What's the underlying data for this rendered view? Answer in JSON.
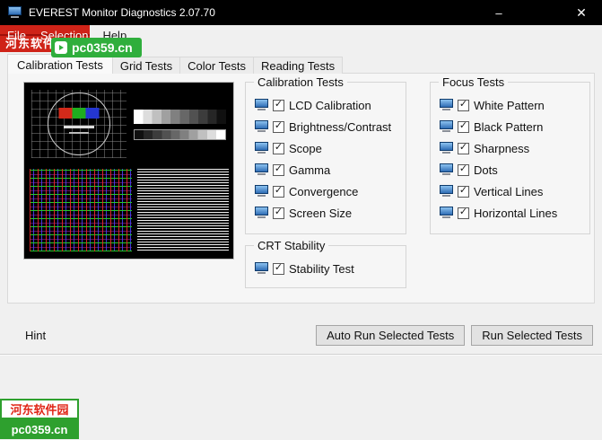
{
  "window": {
    "title": "EVEREST Monitor Diagnostics 2.07.70",
    "controls": {
      "minimize": "–",
      "close": "✕"
    }
  },
  "menu": {
    "items": [
      {
        "label": "File"
      },
      {
        "label": "Selection"
      },
      {
        "label": "Help"
      }
    ]
  },
  "tabs": [
    {
      "label": "Calibration Tests",
      "active": true
    },
    {
      "label": "Grid Tests",
      "active": false
    },
    {
      "label": "Color Tests",
      "active": false
    },
    {
      "label": "Reading Tests",
      "active": false
    }
  ],
  "preview": {
    "name": "monitor-test-pattern-preview",
    "quadrants": [
      "calibration-card",
      "grayscale-steps",
      "convergence-grid",
      "horizontal-lines"
    ]
  },
  "calibration_group": {
    "title": "Calibration Tests",
    "items": [
      {
        "label": "LCD Calibration",
        "checked": true
      },
      {
        "label": "Brightness/Contrast",
        "checked": true
      },
      {
        "label": "Scope",
        "checked": true
      },
      {
        "label": "Gamma",
        "checked": true
      },
      {
        "label": "Convergence",
        "checked": true
      },
      {
        "label": "Screen Size",
        "checked": true
      }
    ]
  },
  "focus_group": {
    "title": "Focus Tests",
    "items": [
      {
        "label": "White Pattern",
        "checked": true
      },
      {
        "label": "Black Pattern",
        "checked": true
      },
      {
        "label": "Sharpness",
        "checked": true
      },
      {
        "label": "Dots",
        "checked": true
      },
      {
        "label": "Vertical Lines",
        "checked": true
      },
      {
        "label": "Horizontal Lines",
        "checked": true
      }
    ]
  },
  "crt_group": {
    "title": "CRT Stability",
    "items": [
      {
        "label": "Stability Test",
        "checked": true
      }
    ]
  },
  "buttons": {
    "auto_run": "Auto Run Selected Tests",
    "run": "Run Selected Tests"
  },
  "hint": {
    "label": "Hint"
  },
  "watermarks": {
    "top": {
      "logo_text": "河东软件园",
      "badge_text": "pc0359.cn"
    },
    "bottom": {
      "logo_text": "河东软件园",
      "badge_text": "pc0359.cn"
    }
  },
  "colors": {
    "titlebar_bg": "#000000",
    "watermark_red": "#cf2318",
    "watermark_green": "#2ea02e"
  }
}
